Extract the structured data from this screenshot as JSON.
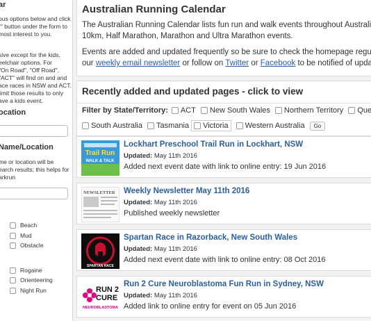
{
  "sidebar": {
    "heading_top": "ar",
    "intro_lines": [
      "ous options below and click",
      "r\" button under the form to",
      "most interest to you."
    ],
    "info_lines": [
      "sive except for the kids,",
      "eelchair options. For",
      "\"On Road\", \"Off Road\",",
      "\"ACT\" will find on and and",
      "ace races in NSW and ACT.",
      "limit those results to only",
      "ave a kids event."
    ],
    "location_heading": "ocation",
    "name_heading": "Name/Location",
    "name_help_lines": [
      "me or location will be",
      "earch results; this helps for",
      "arkrun"
    ],
    "checks_a": [
      "Beach",
      "Mud",
      "Obstacle"
    ],
    "checks_b": [
      "Rogaine",
      "Orienteering",
      "Night Run"
    ]
  },
  "intro": {
    "title": "Australian Running Calendar",
    "p1_line1": "The Australian Running Calendar lists fun run and walk events throughout Australia inc",
    "p1_line2": "10km, Half Marathon, Marathon and Ultra Marathon events.",
    "p2_line1": "Events are added and updated frequently so be sure to check the homepage regularly",
    "p2_pre": "our ",
    "p2_link1": "weekly email newsletter",
    "p2_mid": " or follow on ",
    "p2_link2": "Twitter",
    "p2_or": " or ",
    "p2_link3": "Facebook",
    "p2_post": " to be notified of updates"
  },
  "recent": {
    "title": "Recently added and updated pages - click to view",
    "filter_label": "Filter by State/Territory:",
    "states_row1": [
      "ACT",
      "New South Wales",
      "Northern Territory",
      "Quee"
    ],
    "states_row2": [
      "South Australia",
      "Tasmania",
      "Victoria",
      "Western Australia"
    ],
    "go_label": "Go"
  },
  "updated_label": "Updated:",
  "items": [
    {
      "title": "Lockhart Preschool Trail Run in Lockhart, NSW",
      "date": "May 11th 2016",
      "desc": "Added next event date with link to online entry: 19 Jun 2016",
      "thumb_text": [
        "Trail Run",
        "WALK & TALK"
      ]
    },
    {
      "title": "Weekly Newsletter May 11th 2016",
      "date": "May 11th 2016",
      "desc": "Published weekly newsletter",
      "thumb_text": [
        "NEWSLETTER"
      ]
    },
    {
      "title": "Spartan Race in Razorback, New South Wales",
      "date": "May 11th 2016",
      "desc": "Added next event date with link to online entry: 08 Oct 2016",
      "thumb_text": [
        "SPARTAN RACE"
      ]
    },
    {
      "title": "Run 2 Cure Neuroblastoma Fun Run in Sydney, NSW",
      "date": "May 11th 2016",
      "desc": "Added link to online entry for event on 05 Jun 2016",
      "thumb_text": [
        "RUN 2",
        "CURE",
        "NEUROBLASTOMA"
      ]
    }
  ]
}
